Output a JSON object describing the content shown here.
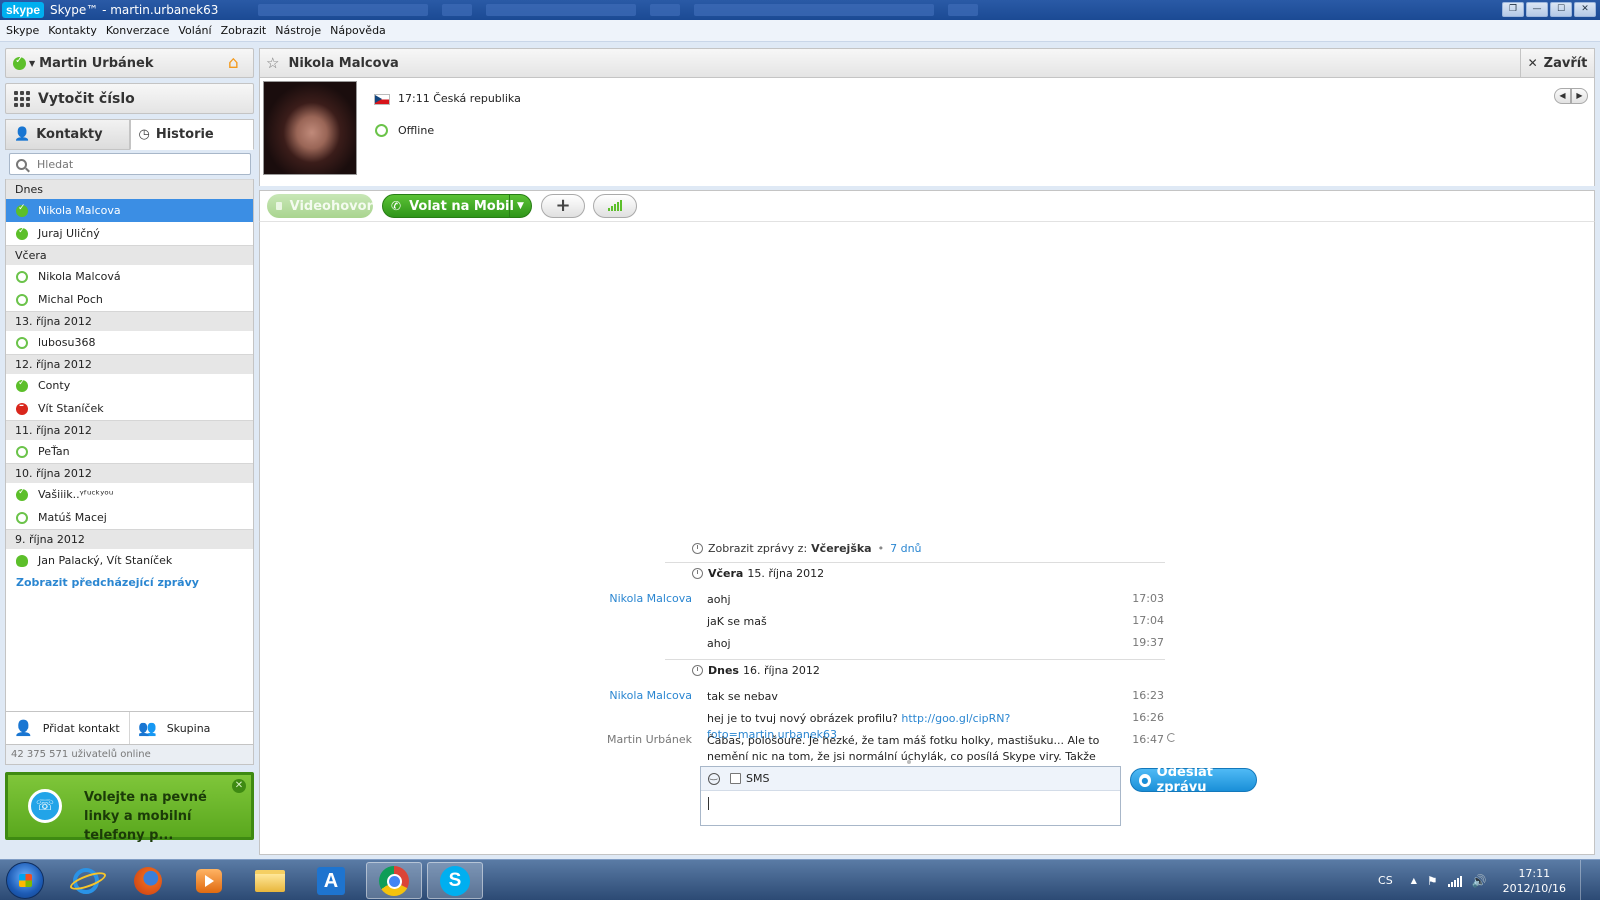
{
  "window": {
    "logo": "skype",
    "title": "Skype™ - martin.urbanek63"
  },
  "menu": [
    "Skype",
    "Kontakty",
    "Konverzace",
    "Volání",
    "Zobrazit",
    "Nástroje",
    "Nápověda"
  ],
  "sidebar": {
    "user_name": "Martin Urbánek",
    "dial_label": "Vytočit číslo",
    "tabs": [
      {
        "label": "Kontakty",
        "active": false
      },
      {
        "label": "Historie",
        "active": true
      }
    ],
    "search_placeholder": "Hledat",
    "history": [
      {
        "type": "group",
        "label": "Dnes"
      },
      {
        "type": "contact",
        "name": "Nikola Malcova",
        "status": "online",
        "selected": true
      },
      {
        "type": "contact",
        "name": "Juraj Uličný",
        "status": "online"
      },
      {
        "type": "group",
        "label": "Včera"
      },
      {
        "type": "contact",
        "name": "Nikola Malcová",
        "status": "offline"
      },
      {
        "type": "contact",
        "name": "Michal Poch",
        "status": "offline"
      },
      {
        "type": "group",
        "label": "13. října 2012"
      },
      {
        "type": "contact",
        "name": "lubosu368",
        "status": "offline"
      },
      {
        "type": "group",
        "label": "12. října 2012"
      },
      {
        "type": "contact",
        "name": "Conty",
        "status": "online"
      },
      {
        "type": "contact",
        "name": "Vít Staníček",
        "status": "busy"
      },
      {
        "type": "group",
        "label": "11. října 2012"
      },
      {
        "type": "contact",
        "name": "PeŤan",
        "status": "offline"
      },
      {
        "type": "group",
        "label": "10. října 2012"
      },
      {
        "type": "contact",
        "name": "Vašiiik..ᵞᶠᵘᶜᵏʸᵒᵘ",
        "status": "online"
      },
      {
        "type": "contact",
        "name": "Matúš Macej",
        "status": "offline"
      },
      {
        "type": "group",
        "label": "9. října 2012"
      },
      {
        "type": "contact",
        "name": "Jan Palacký, Vít Staníček",
        "status": "group"
      }
    ],
    "show_previous": "Zobrazit předcházející zprávy",
    "add_contact": "Přidat kontakt",
    "group_button": "Skupina",
    "users_online": "42 375 571 uživatelů online",
    "promo_text": "Volejte na pevné linky a mobilní telefony p...",
    "colors": {
      "selected": "#3b8ee4",
      "link": "#2a86d1",
      "online": "#5cbf2a",
      "busy": "#d9261c"
    }
  },
  "conversation": {
    "title": "Nikola Malcova",
    "close_label": "Zavřít",
    "local_time": "17:11 Česká republika",
    "status": "Offline",
    "buttons": {
      "video": "Videohovor",
      "call": "Volat na Mobil"
    },
    "show_messages_from": {
      "prefix": "Zobrazit zprávy z:",
      "selected": "Včerejška",
      "other": "7 dnů"
    },
    "days": [
      {
        "bold": "Včera",
        "date": "15. října 2012",
        "messages": [
          {
            "sender": "Nikola Malcova",
            "text": "aohj",
            "time": "17:03"
          },
          {
            "sender": "",
            "text": "jaK se maš",
            "time": "17:04"
          },
          {
            "sender": "",
            "text": "ahoj",
            "time": "19:37"
          }
        ]
      },
      {
        "bold": "Dnes",
        "date": "16. října 2012",
        "messages": [
          {
            "sender": "Nikola Malcova",
            "text": "tak se nebav",
            "time": "16:23"
          },
          {
            "sender": "",
            "text": "hej je to tvuj nový obrázek profilu?",
            "link": "http://goo.gl/cipRN?foto=martin.urbanek63",
            "time": "16:26"
          },
          {
            "sender": "Martin Urbánek",
            "text": "Čabas, pološoure. Je hezké, že tam máš fotku holky, mastišuku... Ale to nemění nic na tom, že jsi normální úchylák, co posílá Skype viry. Takže zpytuj své svědomí! A přestaň posílat sračky. Nebo ti hodím 2 kočičince do okenic a nabluju tě za límeček. Aj možná i za triko. A zatočím s tvým zasifleným polo-šourkem Zatím čauky, mňauky... Marťas.",
            "time": "16:47"
          }
        ]
      }
    ],
    "compose": {
      "sms_label": "SMS",
      "send_label": "Odeslat zprávu"
    }
  },
  "taskbar": {
    "lang": "CS",
    "time": "17:11",
    "date": "2012/10/16"
  }
}
